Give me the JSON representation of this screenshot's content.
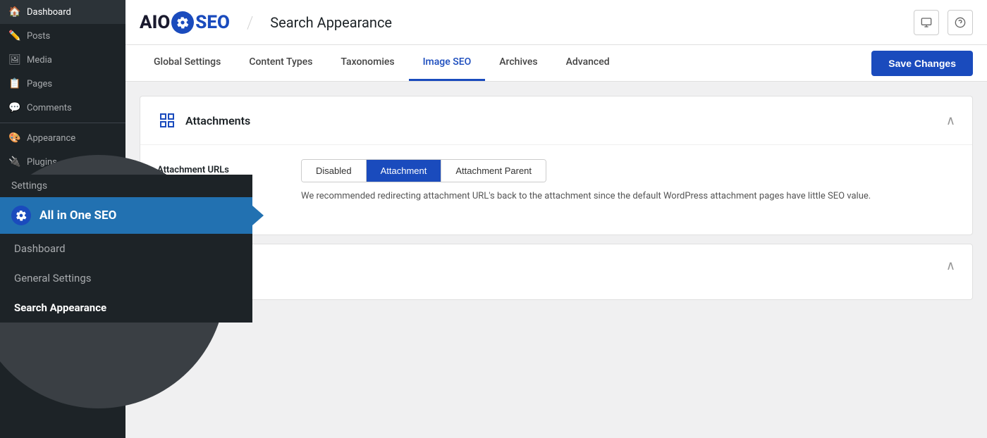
{
  "sidebar": {
    "items": [
      {
        "id": "dashboard",
        "label": "Dashboard",
        "icon": "🏠"
      },
      {
        "id": "posts",
        "label": "Posts",
        "icon": "📄"
      },
      {
        "id": "media",
        "label": "Media",
        "icon": "🖼"
      },
      {
        "id": "pages",
        "label": "Pages",
        "icon": "📋"
      },
      {
        "id": "comments",
        "label": "Comments",
        "icon": "💬"
      },
      {
        "id": "appearance",
        "label": "Appearance",
        "icon": "🎨"
      },
      {
        "id": "plugins",
        "label": "Plugins",
        "icon": "🔌"
      }
    ]
  },
  "header": {
    "logo_text_aio": "AIO",
    "logo_text_seo": "SEO",
    "divider": "/",
    "title": "Search Appearance"
  },
  "tabs": {
    "items": [
      {
        "id": "global-settings",
        "label": "Global Settings",
        "active": false
      },
      {
        "id": "content-types",
        "label": "Content Types",
        "active": false
      },
      {
        "id": "taxonomies",
        "label": "Taxonomies",
        "active": false
      },
      {
        "id": "image-seo",
        "label": "Image SEO",
        "active": true
      },
      {
        "id": "archives",
        "label": "Archives",
        "active": false
      },
      {
        "id": "advanced",
        "label": "Advanced",
        "active": false
      }
    ],
    "save_button": "Save Changes"
  },
  "attachments_card": {
    "title": "Attachments",
    "icon": "attachment-icon",
    "field_label": "hment URLs",
    "buttons": [
      {
        "id": "disabled",
        "label": "Disabled",
        "active": false
      },
      {
        "id": "attachment",
        "label": "Attachment",
        "active": true
      },
      {
        "id": "attachment-parent",
        "label": "Attachment Parent",
        "active": false
      }
    ],
    "description": "We recommended redirecting attachment URL's back to the attachment since the default WordPress attachment pages have little SEO value."
  },
  "aioseo_menu": {
    "plugin_name": "All in One SEO",
    "settings_label": "Settings",
    "submenu_items": [
      {
        "id": "dashboard",
        "label": "Dashboard",
        "active": false
      },
      {
        "id": "general-settings",
        "label": "General Settings",
        "active": false
      },
      {
        "id": "search-appearance",
        "label": "Search Appearance",
        "active": true
      }
    ]
  }
}
